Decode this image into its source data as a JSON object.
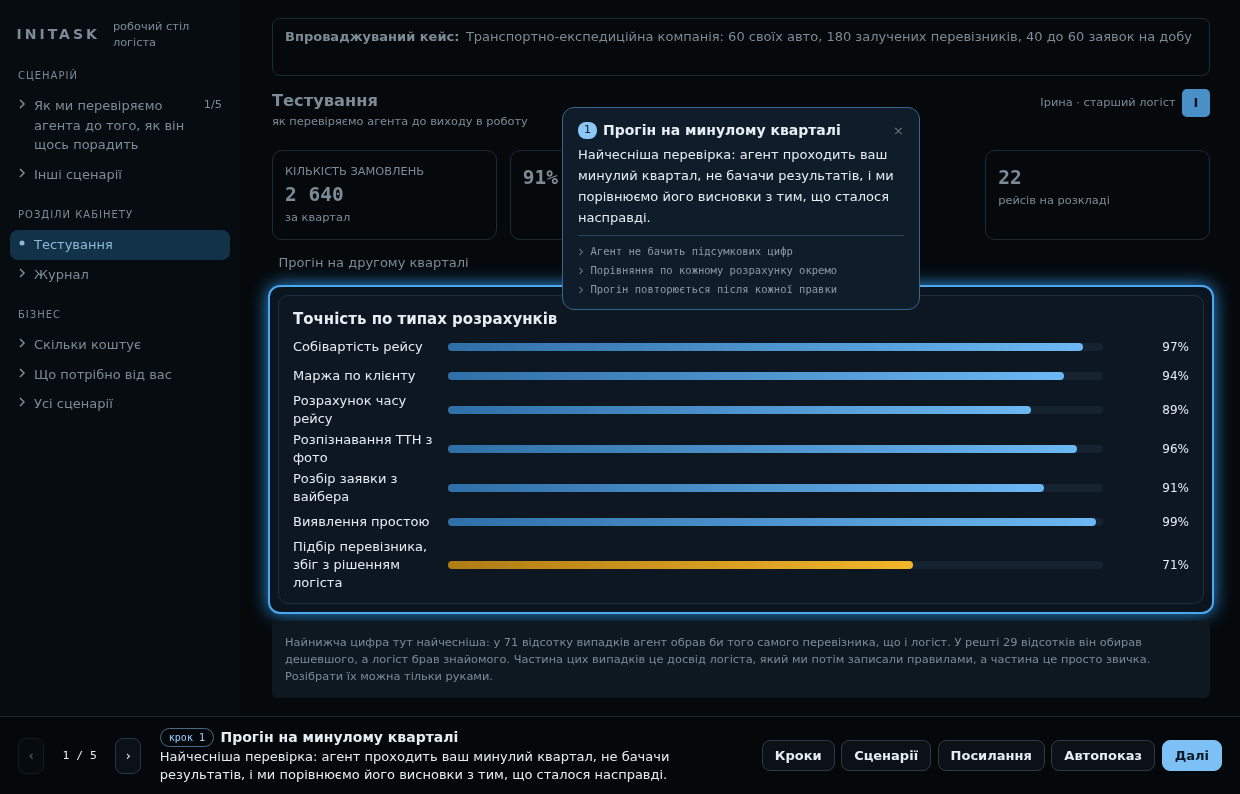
{
  "sidebar": {
    "logo": "INITASK",
    "subtitle": "робочий стіл логіста",
    "sections": [
      {
        "title": "СЦЕНАРІЙ",
        "items": [
          {
            "label": "Як ми перевіряємо агента до того, як він щось порадить",
            "count": "1/5",
            "selected": false
          },
          {
            "label": "Інші сценарії",
            "selected": false
          }
        ]
      },
      {
        "title": "РОЗДІЛИ КАБІНЕТУ",
        "items": [
          {
            "label": "Тестування",
            "selected": true
          },
          {
            "label": "Журнал",
            "selected": false
          }
        ]
      },
      {
        "title": "БІЗНЕС",
        "items": [
          {
            "label": "Скільки коштує",
            "selected": false
          },
          {
            "label": "Що потрібно від вас",
            "selected": false
          },
          {
            "label": "Усі сценарії",
            "selected": false
          }
        ]
      }
    ]
  },
  "case_banner": {
    "label": "Впроваджуваний кейс:",
    "text": "Транспортно-експедиційна компанія: 60 своїх авто, 180 залучених перевізників, 40 до 60 заявок на добу"
  },
  "page": {
    "title": "Тестування",
    "subtitle": "як перевіряємо агента до виходу в роботу",
    "user": "Ірина · старший логіст",
    "avatar": "І"
  },
  "stats": [
    {
      "label": "КІЛЬКІСТЬ ЗАМОВЛЕНЬ",
      "value": "2 640",
      "note": "за квартал"
    },
    {
      "value": "91%"
    },
    {
      "value": "22",
      "note": "рейсів на розкладі"
    }
  ],
  "next_run": {
    "title": "Прогін на другому кварталі"
  },
  "chart": {
    "title": "Точність по типах розрахунків",
    "rows": [
      {
        "label": "Собівартість рейсу",
        "level": 0.97,
        "value": "97%",
        "kind": "ok"
      },
      {
        "label": "Маржа по клієнту",
        "level": 0.94,
        "value": "94%",
        "kind": "ok"
      },
      {
        "label": "Розрахунок часу рейсу",
        "level": 0.89,
        "value": "89%",
        "kind": "ok"
      },
      {
        "label": "Розпізнавання ТТН з фото",
        "level": 0.96,
        "value": "96%",
        "kind": "ok"
      },
      {
        "label": "Розбір заявки з вайбера",
        "level": 0.91,
        "value": "91%",
        "kind": "ok"
      },
      {
        "label": "Виявлення простою",
        "level": 0.99,
        "value": "99%",
        "kind": "ok"
      },
      {
        "label": "Підбір перевізника, збіг з рішенням логіста",
        "level": 0.71,
        "value": "71%",
        "kind": "low"
      }
    ]
  },
  "note": {
    "text": "Найнижча цифра тут найчесніша: у 71 відсотку випадків агент обрав би того самого перевізника, що і логіст. У решті 29 відсотків він обирав дешевшого, а логіст брав знайомого. Частина цих випадків це досвід логіста, який ми потім записали правилами, а частина це просто звичка. Розібрати їх можна тільки руками."
  },
  "popover": {
    "step": "1",
    "title": "Прогін на минулому кварталі",
    "close": "×",
    "text": "Найчесніша перевірка: агент проходить ваш минулий квартал, не бачачи результатів, і ми порівнюємо його висновки з тим, що сталося насправді.",
    "points": [
      "Агент не бачить підсумкових цифр",
      "Порівняння по кожному розрахунку окремо",
      "Прогін повторюється після кожної правки"
    ]
  },
  "tour_bar": {
    "prev": "‹",
    "counter": "1 / 5",
    "next": "›",
    "badge": "крок 1",
    "title": "Прогін на минулому кварталі",
    "text": "Найчесніша перевірка: агент проходить ваш минулий квартал, не бачачи результатів, і ми порівнюємо його висновки з тим, що сталося насправді.",
    "buttons": [
      {
        "label": "Кроки",
        "primary": false
      },
      {
        "label": "Сценарії",
        "primary": false
      },
      {
        "label": "Посилання",
        "primary": false
      },
      {
        "label": "Автопоказ",
        "primary": false
      },
      {
        "label": "Далі",
        "primary": true
      }
    ]
  }
}
